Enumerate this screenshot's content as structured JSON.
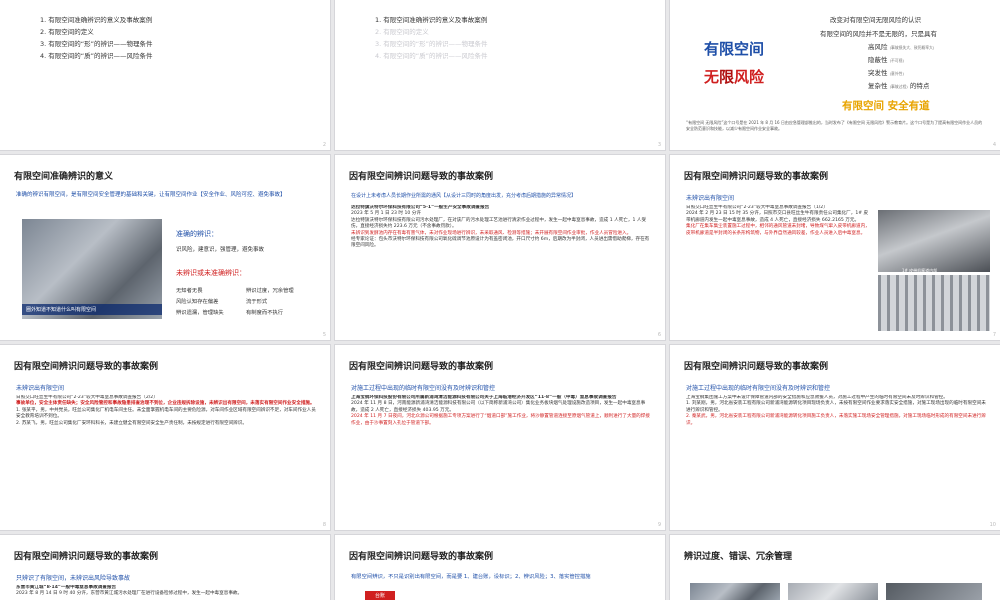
{
  "slide1": {
    "toc": [
      "1. 有限空间准确辨识的意义及事故案例",
      "2. 有限空间的定义",
      "3. 有限空间的“形”的辨识——物理条件",
      "4. 有限空间的“质”的辨识——风险条件"
    ]
  },
  "slide2": {
    "toc": [
      "1. 有限空间准确辨识的意义及事故案例",
      "2. 有限空间的定义",
      "3. 有限空间的“形”的辨识——物理条件",
      "4. 有限空间的“质”的辨识——风险条件"
    ]
  },
  "slide3": {
    "title1": "有限空间",
    "title2_a": "无",
    "title2_b": "限",
    "title2_c": "风险",
    "line1": "改变对有限空间无限风险的认识",
    "line2": "有限空间的风险并不是无限的，只是具有",
    "items": [
      "高风险",
      "隐蔽性",
      "突发性",
      "复杂性"
    ],
    "items_note": [
      "(事故损失大、致死概率大)",
      "(不可视)",
      "(意外性)",
      "(事故过程)"
    ],
    "suffix": "的特点",
    "slogan": "有限空间 安全有道",
    "note": "“有限空间 无限风险”这个口号是在 2021 年 8 月 16 日由应急管理部推出的，当时发布了《有限空间 无限风险》警示教育片。这个口号是为了提高有限空间作业人员的安全防范意识和技能，以减少有限空间作业安全事故。"
  },
  "slide4": {
    "title": "有限空间准确辨识的意义",
    "intro": "准确的辨识有限空间，是有限空间安全管理的基础和关键，让有限空间作业【安全作业、风险可控、避免事故】",
    "caption": "圈外知道不知道什么叫有限空间",
    "right_title": "准确的辨识：",
    "right_items": "识风险，建意识，强管理，避免事故",
    "wrong_title": "未辨识或未准确辨识：",
    "wrong_items": [
      "无知者无畏",
      "辨识过度，冗余管理",
      "风险认知存在偏差",
      "流于形式",
      "辨识遗漏，管理缺失",
      "有制度而不执行"
    ]
  },
  "slide5": {
    "title": "因有限空间辨识问题导致的事故案例",
    "sub": "在设计上未考虑人员长期作业所需的通风【从设计三同时的角度出发，充分考虑后期措施的异常情况】",
    "case_title": "达拉特旗沃特尔环保科技有限公司“5·1”一般生产安全事故调查报告",
    "date": "2023 年 5 月 1 日 23 时 10 分许",
    "p1": "达拉特旗沃特尔环保科技有限公司污水处理厂，在对该厂的污水处理工艺池进行清淤作业过程中，发生一起中毒窒息事故，造成 1 人死亡，1 人受伤，直接经济损失约 223.6 万元（不含事故罚款）。",
    "p2": "未辨识到发酵池内存在有毒有害气体，未对作业现场进行辨识，未采取通风、检测等措施；未开展有限空间作业审批，作业人员冒险进入。",
    "p3": "经专家论证：包头市沃特尔环保科技有限公司氧化硫调节池原设计为有盖密闭池，开口尺寸约 6m，后期改为半封闭，人员进出需借助爬梯，存在有限空间风险。"
  },
  "slide6": {
    "title": "因有限空间辨识问题导致的事故案例",
    "sub": "未辨识出有限空间",
    "case_title": "日照交口旺丝生牛有限公司“2·23”较大中毒窒息事故调查报告（1/2）",
    "p1": "2024 年 2 月 23 日 15 时 35 分许，日照市交口县旺丝生牛有限责任公司集化厂，1# 皮带机廊道内发生一起中毒窒息事故，造成 4 人死亡，直接经济损失 662.2165 万元。",
    "p2": "集化厂在集车集尘装置施工过程中，相邻的通风管道未封堵，导致煤气窜入皮带机廊道内，皮带机廊道是半封闭的长条形构筑物，与外界自然通风较差，作业人员进入后中毒窒息。",
    "img_label": "1# 皮带机廊道内部"
  },
  "slide7": {
    "title": "因有限空间辨识问题导致的事故案例",
    "sub": "未辨识出有限空间",
    "case_title": "日照交口旺丝生牛有限公司“2·23”较大中毒窒息事故调查报告（2/2）",
    "p1": "事故单位，安全主体责任缺失；安全风险管控和事故隐患排查治理不到位，企业违规拆除设施，未辨识出有限空间，未落实有限空间作业安全措施。",
    "p2": "1. 张某平，男，中共党员，旺丝公司集化厂机电车间主任。未全面掌握机电车间的主要危险源，对车间作业区域有限空间辨识不足，对车间作业人员安全教育培训不到位。",
    "p3": "2. 苏某飞，男，旺丝公司集化厂安环科科长，未建立健全有限空间安全生产责任制，未按规定进行有限空间辨识。"
  },
  "slide8": {
    "title": "因有限空间辨识问题导致的事故案例",
    "sub": "对施工过程中出现的临时有限空间没有及时辨识和管控",
    "case_title": "上海宝钢环保科技股份有限公司所属新浦湾清洁能源科技有限公司关于上海临港经济开发区“11·8”一般（中毒）窒息事故调查报告",
    "p1": "2024 年 11 月 8 日，河南能源新浦湾清洁能源科技有限公司（以下简称新浦湾公司）集化业务板块烟气处理设施改造项目，发生一起中毒窒息事故，造成 2 人死亡，直接经济损失 403.95 万元。",
    "p2": "2024 年 11 月 7 日夜间，河北众源公司根据施工专项方案进行了“烟道口部”施工作业，将沙静置管道连接至原烟气管道上，顺利进行了大量的焊接作业，由于沙事置刻入孔位于管道下部。"
  },
  "slide9": {
    "title": "因有限空间辨识问题导致的事故案例",
    "sub": "对施工过程中出现的临时有限空间没有及时辨识和管控",
    "p1": "上海宝钢集团施工方案中未设计保障管道内部的安全措施和应急救援人员，对施工过程中产生的临时有限空间未及时辨识和管控。",
    "p2": "1. 刘某刚，男，河北省安装工程有限公司新浦湾能源转化项目现场负责人，未按有限空间作业要求落实安全措施，对施工现场出现的临时有限空间未进行辨识和管控。",
    "p3": "2. 秦某武，男，河北省安装工程有限公司新浦湾能源转化项目施工负责人，未落实施工现场安全管理措施，对施工现场临时形成的有限空间未进行辨识。"
  },
  "slide10": {
    "title": "因有限空间辨识问题导致的事故案例",
    "sub": "只辨识了有限空间，未辨识出风险导致事故",
    "case_title": "东营市黄江城“8·14”一般中毒窒息事故调查报告",
    "p1": "2023 年 8 月 14 日 9 时 40 分许，东营市黄江城污水处理厂在进行设备检修过程中，发生一起中毒窒息事故。"
  },
  "slide11": {
    "title": "因有限空间辨识问题导致的事故案例",
    "sub": "有限空间辨识，不只是识别出有限空间，而是要 1、建台账，设标识；2、辨识风险；3、落实管控措施",
    "badge": "台账"
  },
  "slide12": {
    "title": "辨识过度、错误、冗余管理"
  },
  "pages": [
    "2",
    "3",
    "4",
    "5",
    "6",
    "7",
    "8",
    "9",
    "10",
    "11",
    "12",
    "13"
  ]
}
